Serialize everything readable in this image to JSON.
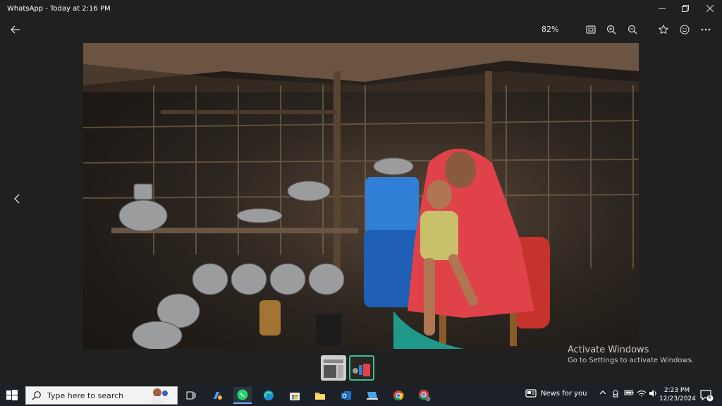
{
  "window": {
    "title": "WhatsApp - Today at 2:16 PM"
  },
  "toolbar": {
    "zoom_level": "82%"
  },
  "watermark": {
    "line1": "Activate Windows",
    "line2": "Go to Settings to activate Windows."
  },
  "taskbar": {
    "search_placeholder": "Type here to search",
    "news_label": "News for you",
    "time": "2:23 PM",
    "date": "12/23/2024",
    "notification_count": "4"
  },
  "colors": {
    "background": "#202020",
    "taskbar": "#1c2128",
    "selected_thumb": "#38c1a0",
    "whatsapp": "#25d366"
  },
  "icons": {
    "back": "arrow-left-icon",
    "fit": "fit-screen-icon",
    "zoom_in": "zoom-in-icon",
    "zoom_out": "zoom-out-icon",
    "favorite": "star-icon",
    "emoji": "smiley-icon",
    "more": "more-dots-icon",
    "prev": "chevron-left-icon"
  }
}
